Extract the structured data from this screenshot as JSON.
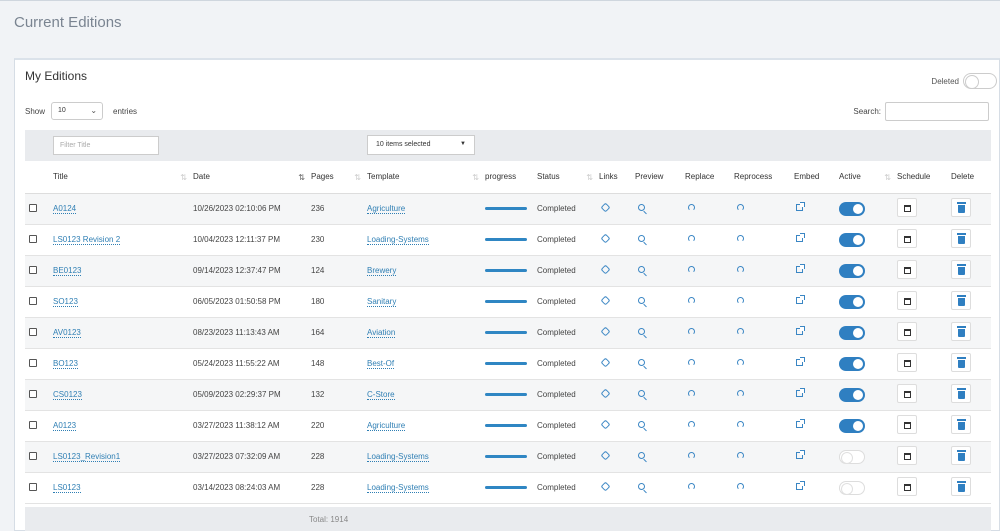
{
  "page": {
    "title": "Current Editions"
  },
  "card": {
    "title": "My Editions",
    "deleted_label": "Deleted",
    "show_label": "Show",
    "entries_label": "entries",
    "page_size": "10",
    "search_label": "Search:"
  },
  "filters": {
    "title_placeholder": "Filter Title",
    "template_select": "10 items selected"
  },
  "columns": [
    "Title",
    "Date",
    "Pages",
    "Template",
    "progress",
    "Status",
    "Links",
    "Preview",
    "Replace",
    "Reprocess",
    "Embed",
    "Active",
    "Schedule",
    "Delete"
  ],
  "rows": [
    {
      "title": "A0124",
      "date": "10/26/2023 02:10:06 PM",
      "pages": "236",
      "template": "Agriculture",
      "status": "Completed",
      "active": true
    },
    {
      "title": "LS0123 Revision 2",
      "date": "10/04/2023 12:11:37 PM",
      "pages": "230",
      "template": "Loading-Systems",
      "status": "Completed",
      "active": true
    },
    {
      "title": "BE0123",
      "date": "09/14/2023 12:37:47 PM",
      "pages": "124",
      "template": "Brewery",
      "status": "Completed",
      "active": true
    },
    {
      "title": "SO123",
      "date": "06/05/2023 01:50:58 PM",
      "pages": "180",
      "template": "Sanitary",
      "status": "Completed",
      "active": true
    },
    {
      "title": "AV0123",
      "date": "08/23/2023 11:13:43 AM",
      "pages": "164",
      "template": "Aviation",
      "status": "Completed",
      "active": true
    },
    {
      "title": "BO123",
      "date": "05/24/2023 11:55:22 AM",
      "pages": "148",
      "template": "Best-Of",
      "status": "Completed",
      "active": true
    },
    {
      "title": "CS0123",
      "date": "05/09/2023 02:29:37 PM",
      "pages": "132",
      "template": "C-Store",
      "status": "Completed",
      "active": true
    },
    {
      "title": "A0123",
      "date": "03/27/2023 11:38:12 AM",
      "pages": "220",
      "template": "Agriculture",
      "status": "Completed",
      "active": true
    },
    {
      "title": "LS0123_Revision1",
      "date": "03/27/2023 07:32:09 AM",
      "pages": "228",
      "template": "Loading-Systems",
      "status": "Completed",
      "active": false
    },
    {
      "title": "LS0123",
      "date": "03/14/2023 08:24:03 AM",
      "pages": "228",
      "template": "Loading-Systems",
      "status": "Completed",
      "active": false
    }
  ],
  "footer": {
    "total": "Total: 1914"
  },
  "colors": {
    "accent": "#2f7fc1",
    "link": "#2f7fb4"
  }
}
